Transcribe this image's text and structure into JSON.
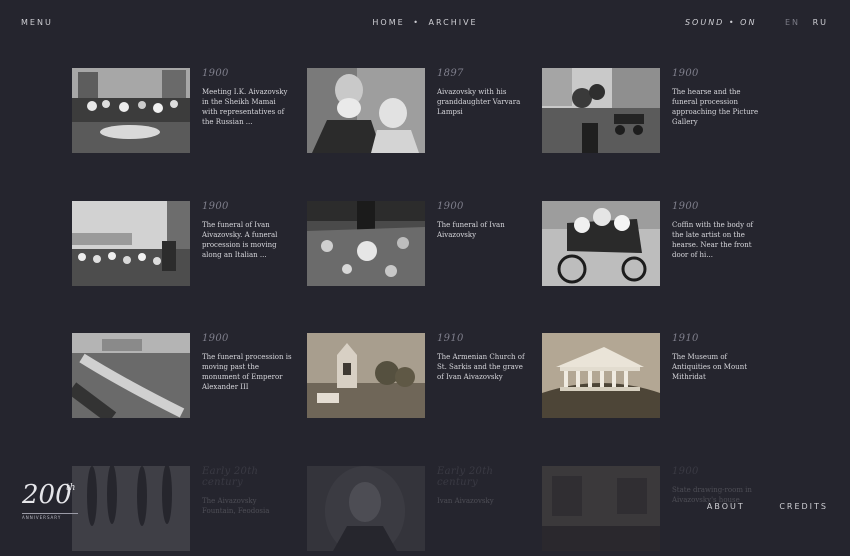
{
  "header": {
    "menu_label": "MENU",
    "breadcrumb": [
      "HOME",
      "ARCHIVE"
    ],
    "breadcrumb_separator": "•",
    "sound_label": "SOUND • ON",
    "languages": [
      {
        "code": "EN",
        "active": true
      },
      {
        "code": "RU",
        "active": false
      }
    ]
  },
  "archive_items": [
    {
      "year": "1900",
      "title": "Meeting I.K. Aivazovsky in the Sheikh Mamai with representatives of the Russian ...",
      "photo": "garden-crowd"
    },
    {
      "year": "1897",
      "title": "Aivazovsky with his granddaughter Varvara Lampsi",
      "photo": "old-man-and-child"
    },
    {
      "year": "1900",
      "title": "The hearse and the funeral procession approaching the Picture Gallery",
      "photo": "funeral-street"
    },
    {
      "year": "1900",
      "title": "The funeral of Ivan Aivazovsky. A funeral procession is moving along an Italian ...",
      "photo": "funeral-crowd-street"
    },
    {
      "year": "1900",
      "title": "The funeral of Ivan Aivazovsky",
      "photo": "funeral-church"
    },
    {
      "year": "1900",
      "title": "Coffin with the body of the late artist on the hearse. Near the front door of hi...",
      "photo": "hearse-flowers"
    },
    {
      "year": "1900",
      "title": "The funeral procession is moving past the monument of Emperor Alexander III",
      "photo": "procession-square"
    },
    {
      "year": "1910",
      "title": "The Armenian Church of St. Sarkis and the grave of Ivan Aivazovsky",
      "photo": "armenian-church"
    },
    {
      "year": "1910",
      "title": "The Museum of Antiquities on Mount Mithridat",
      "photo": "museum-antiquities"
    },
    {
      "year": "Early 20th century",
      "title": "The Aivazovsky Fountain, Feodosia",
      "photo": "fountain-poplars"
    },
    {
      "year": "Early 20th century",
      "title": "Ivan Aivazovsky",
      "photo": "portrait"
    },
    {
      "year": "1900",
      "title": "State drawing-room in Aivazovsky's house",
      "photo": "drawing-room"
    }
  ],
  "logo": {
    "number": "200",
    "suffix": "th",
    "caption": "ANNIVERSARY"
  },
  "footer": {
    "about_label": "ABOUT",
    "credits_label": "CREDITS"
  },
  "colors": {
    "background": "#25252e",
    "text": "#d6d6db",
    "muted": "#7f7f8c"
  }
}
